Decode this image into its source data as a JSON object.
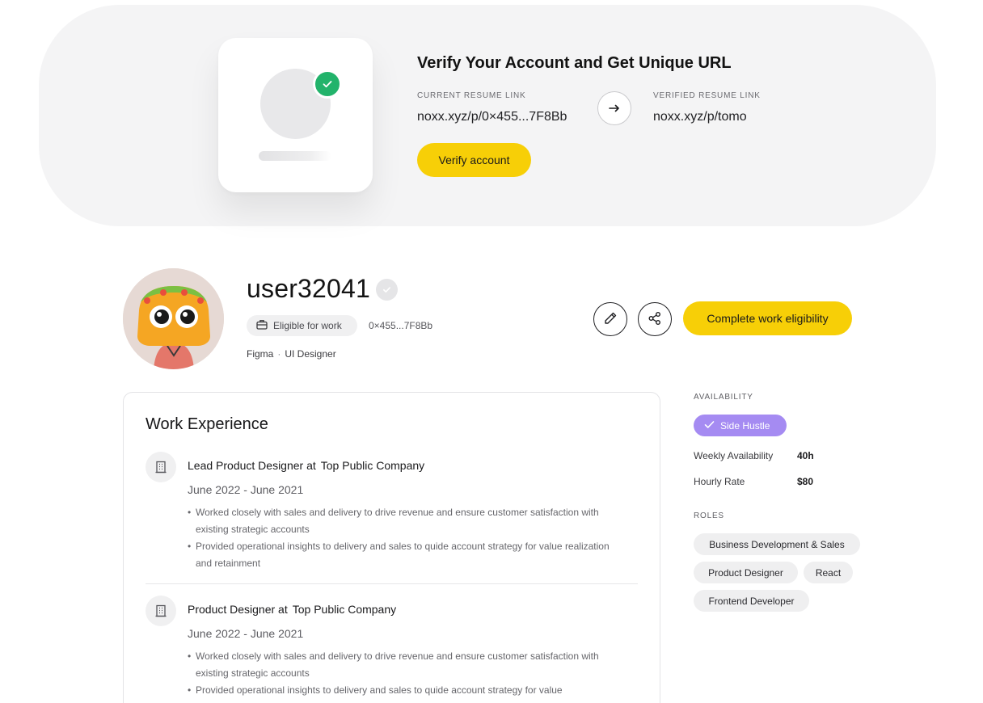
{
  "verify_banner": {
    "title": "Verify Your Account and Get Unique URL",
    "current_label": "CURRENT RESUME LINK",
    "current_value": "noxx.xyz/p/0×455...7F8Bb",
    "verified_label": "VERIFIED RESUME LINK",
    "verified_value": "noxx.xyz/p/tomo",
    "verify_button": "Verify account",
    "accent_color": "#f7cf07",
    "check_color": "#22b36b"
  },
  "profile": {
    "username": "user32041",
    "eligible_label": "Eligible for work",
    "wallet": "0×455...7F8Bb",
    "skill": "Figma",
    "separator": "·",
    "role": "UI Designer",
    "complete_button": "Complete work eligibility"
  },
  "work_experience": {
    "title": "Work Experience",
    "jobs": [
      {
        "position": "Lead Product Designer at",
        "company": "Top Public Company",
        "dates": "June 2022 - June 2021",
        "bullets": [
          "Worked closely with sales and delivery to drive revenue and ensure customer satisfaction with existing strategic accounts",
          "Provided operational insights to delivery and sales to quide account strategy for value realization and retainment"
        ]
      },
      {
        "position": "Product Designer at",
        "company": "Top Public Company",
        "dates": "June 2022 - June 2021",
        "bullets": [
          "Worked closely with sales and delivery to drive revenue and ensure customer satisfaction with existing strategic accounts",
          "Provided operational insights to delivery and sales to quide account strategy for value"
        ]
      }
    ]
  },
  "sidebar": {
    "availability_label": "AVAILABILITY",
    "availability_badge": "Side Hustle",
    "availability_color": "#a58bf2",
    "weekly_label": "Weekly Availability",
    "weekly_value": "40h",
    "rate_label": "Hourly Rate",
    "rate_value": "$80",
    "roles_label": "ROLES",
    "roles": [
      "Business Development & Sales",
      "Product Designer",
      "React",
      "Frontend Developer"
    ]
  }
}
